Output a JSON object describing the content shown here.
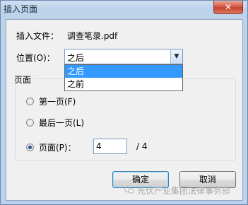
{
  "window": {
    "title": "插入页面",
    "close_glyph": "✕"
  },
  "file": {
    "label": "插入文件：",
    "name": "调查笔录.pdf"
  },
  "position": {
    "label": "位置(O)：",
    "selected": "之后",
    "options": [
      "之后",
      "之前"
    ]
  },
  "page_group": {
    "title": "页面",
    "first_page": "第一页(F)",
    "last_page": "最后一页(L)",
    "page": "页面(P)：",
    "page_value": "4",
    "total": "/ 4",
    "selected_option": "page"
  },
  "buttons": {
    "ok": "确定",
    "cancel": "取消"
  },
  "watermark": {
    "text": "光伏产业集团法律事务部",
    "icon": "wechat-icon"
  }
}
